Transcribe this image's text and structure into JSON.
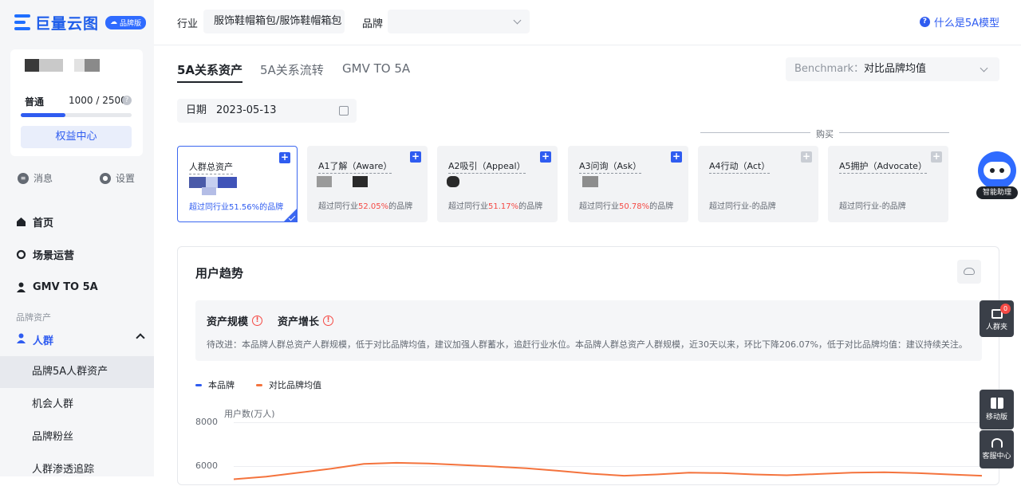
{
  "logo": {
    "text": "巨量云图",
    "badge": "品牌版"
  },
  "account": {
    "level_label": "普通",
    "level_count": "1000 / 2500",
    "progress": 0.4,
    "benefit_button": "权益中心"
  },
  "utils": {
    "messages": "消息",
    "settings": "设置"
  },
  "nav": {
    "home": "首页",
    "scenes": "场景运营",
    "gmv": "GMV TO 5A",
    "section_label": "品牌资产",
    "group": "人群",
    "sub_items": [
      "品牌5A人群资产",
      "机会人群",
      "品牌粉丝",
      "人群渗透追踪"
    ]
  },
  "topbar": {
    "industry_label": "行业",
    "industry_value": "服饰鞋帽箱包/服饰鞋帽箱包",
    "brand_label": "品牌",
    "help_link": "什么是5A模型"
  },
  "tabs": [
    "5A关系资产",
    "5A关系流转",
    "GMV TO 5A"
  ],
  "benchmark": {
    "label": "Benchmark：",
    "value": "对比品牌均值"
  },
  "date": {
    "label": "日期",
    "value": "2023-05-13"
  },
  "buy_label": "购买",
  "cards": [
    {
      "title": "人群总资产",
      "foot_pre": "超过同行业",
      "foot_pct": "51.56%",
      "foot_post": "的品牌"
    },
    {
      "title": "A1了解（Aware）",
      "foot_pre": "超过同行业",
      "foot_pct": "52.05%",
      "foot_post": "的品牌"
    },
    {
      "title": "A2吸引（Appeal）",
      "foot_pre": "超过同行业",
      "foot_pct": "51.17%",
      "foot_post": "的品牌"
    },
    {
      "title": "A3问询（Ask）",
      "foot_pre": "超过同行业",
      "foot_pct": "50.78%",
      "foot_post": "的品牌"
    },
    {
      "title": "A4行动（Act）",
      "foot_pre": "超过同行业",
      "foot_pct": "-",
      "foot_post": "的品牌"
    },
    {
      "title": "A5拥护（Advocate）",
      "foot_pre": "超过同行业",
      "foot_pct": "-",
      "foot_post": "的品牌"
    }
  ],
  "panel": {
    "title": "用户趋势",
    "insight_tags": [
      "资产规模",
      "资产增长"
    ],
    "insight_note": "待改进：本品牌人群总资产人群规模，低于对比品牌均值，建议加强人群蓄水，追赶行业水位。本品牌人群总资产人群规模，近30天以来，环比下降206.07%，低于对比品牌均值：建议持续关注。",
    "legend": [
      "本品牌",
      "对比品牌均值"
    ],
    "y_unit": "用户数(万人)"
  },
  "chart_data": {
    "type": "line",
    "ylabel": "用户数(万人)",
    "y_ticks": [
      "8000",
      "6000"
    ],
    "series": [
      {
        "name": "本品牌",
        "color": "#2f5cf0",
        "values": []
      },
      {
        "name": "对比品牌均值",
        "color": "#f4733d",
        "values": [
          5400,
          5520,
          5700,
          5880,
          6100,
          6150,
          6120,
          6050,
          5980,
          5900,
          5780,
          5650,
          5560,
          5620,
          5700,
          5680,
          5620,
          5580,
          5640,
          5700,
          5720,
          5680,
          5620,
          5560
        ]
      }
    ]
  },
  "floating": {
    "assistant": "智能助理",
    "crowd_folder": "人群夹",
    "crowd_count": "0",
    "mobile": "移动版",
    "service": "客服中心"
  },
  "colors": {
    "accent": "#2f5cf0",
    "warn": "#f54a45",
    "orange": "#f4733d"
  }
}
